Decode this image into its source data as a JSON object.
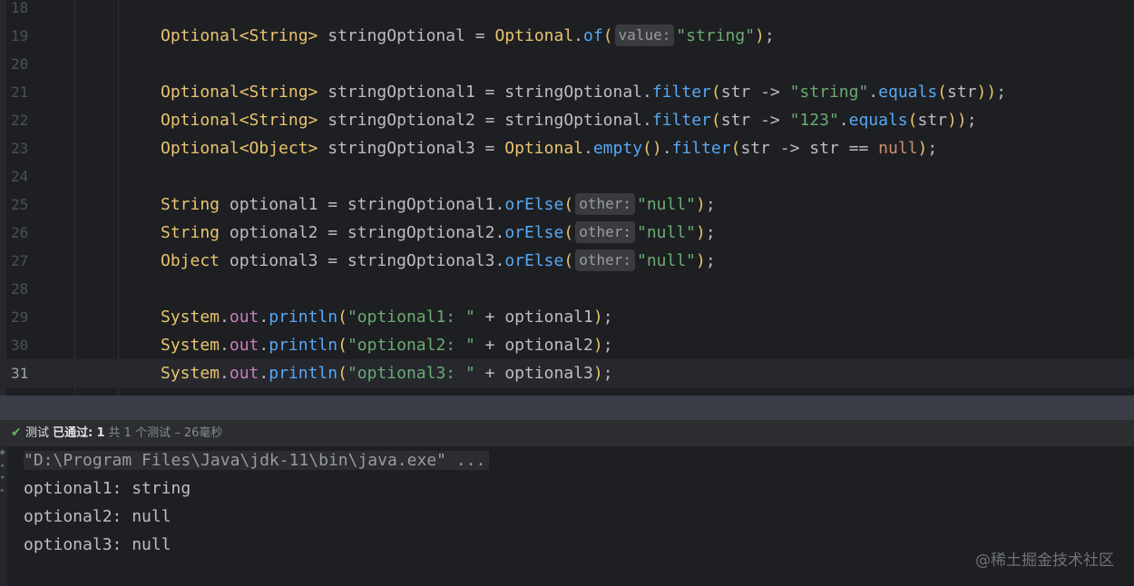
{
  "editor": {
    "lines": [
      {
        "n": "18",
        "tokens": []
      },
      {
        "n": "19",
        "tokens": [
          [
            "t-type",
            "Optional<String>"
          ],
          [
            "t-plain",
            " stringOptional = "
          ],
          [
            "t-type",
            "Optional"
          ],
          [
            "t-plain",
            "."
          ],
          [
            "t-meth",
            "of"
          ],
          [
            "t-type",
            "("
          ],
          [
            "hint",
            "value:"
          ],
          [
            "t-str",
            "\"string\""
          ],
          [
            "t-type",
            ")"
          ],
          [
            "t-plain",
            ";"
          ]
        ]
      },
      {
        "n": "20",
        "tokens": []
      },
      {
        "n": "21",
        "tokens": [
          [
            "t-type",
            "Optional<String>"
          ],
          [
            "t-plain",
            " stringOptional1 = stringOptional."
          ],
          [
            "t-meth",
            "filter"
          ],
          [
            "t-type",
            "("
          ],
          [
            "t-plain",
            "str -> "
          ],
          [
            "t-str",
            "\"string\""
          ],
          [
            "t-plain",
            "."
          ],
          [
            "t-meth",
            "equals"
          ],
          [
            "t-type",
            "("
          ],
          [
            "t-plain",
            "str"
          ],
          [
            "t-type",
            "))"
          ],
          [
            "t-plain",
            ";"
          ]
        ]
      },
      {
        "n": "22",
        "tokens": [
          [
            "t-type",
            "Optional<String>"
          ],
          [
            "t-plain",
            " stringOptional2 = stringOptional."
          ],
          [
            "t-meth",
            "filter"
          ],
          [
            "t-type",
            "("
          ],
          [
            "t-plain",
            "str -> "
          ],
          [
            "t-str",
            "\"123\""
          ],
          [
            "t-plain",
            "."
          ],
          [
            "t-meth",
            "equals"
          ],
          [
            "t-type",
            "("
          ],
          [
            "t-plain",
            "str"
          ],
          [
            "t-type",
            "))"
          ],
          [
            "t-plain",
            ";"
          ]
        ]
      },
      {
        "n": "23",
        "tokens": [
          [
            "t-type",
            "Optional<Object>"
          ],
          [
            "t-plain",
            " stringOptional3 = "
          ],
          [
            "t-type",
            "Optional"
          ],
          [
            "t-plain",
            "."
          ],
          [
            "t-meth",
            "empty"
          ],
          [
            "t-type",
            "()"
          ],
          [
            "t-plain",
            "."
          ],
          [
            "t-meth",
            "filter"
          ],
          [
            "t-type",
            "("
          ],
          [
            "t-plain",
            "str -> str == "
          ],
          [
            "t-kw",
            "null"
          ],
          [
            "t-type",
            ")"
          ],
          [
            "t-plain",
            ";"
          ]
        ]
      },
      {
        "n": "24",
        "tokens": []
      },
      {
        "n": "25",
        "tokens": [
          [
            "t-type",
            "String"
          ],
          [
            "t-plain",
            " optional1 = stringOptional1."
          ],
          [
            "t-meth",
            "orElse"
          ],
          [
            "t-type",
            "("
          ],
          [
            "hint",
            "other:"
          ],
          [
            "t-str",
            "\"null\""
          ],
          [
            "t-type",
            ")"
          ],
          [
            "t-plain",
            ";"
          ]
        ]
      },
      {
        "n": "26",
        "tokens": [
          [
            "t-type",
            "String"
          ],
          [
            "t-plain",
            " optional2 = stringOptional2."
          ],
          [
            "t-meth",
            "orElse"
          ],
          [
            "t-type",
            "("
          ],
          [
            "hint",
            "other:"
          ],
          [
            "t-str",
            "\"null\""
          ],
          [
            "t-type",
            ")"
          ],
          [
            "t-plain",
            ";"
          ]
        ]
      },
      {
        "n": "27",
        "tokens": [
          [
            "t-type",
            "Object"
          ],
          [
            "t-plain",
            " optional3 = stringOptional3."
          ],
          [
            "t-meth",
            "orElse"
          ],
          [
            "t-type",
            "("
          ],
          [
            "hint",
            "other:"
          ],
          [
            "t-str",
            "\"null\""
          ],
          [
            "t-type",
            ")"
          ],
          [
            "t-plain",
            ";"
          ]
        ]
      },
      {
        "n": "28",
        "tokens": []
      },
      {
        "n": "29",
        "tokens": [
          [
            "t-type",
            "System"
          ],
          [
            "t-plain",
            "."
          ],
          [
            "t-field",
            "out"
          ],
          [
            "t-plain",
            "."
          ],
          [
            "t-meth",
            "println"
          ],
          [
            "t-type",
            "("
          ],
          [
            "t-str",
            "\"optional1: \""
          ],
          [
            "t-plain",
            " + optional1"
          ],
          [
            "t-type",
            ")"
          ],
          [
            "t-plain",
            ";"
          ]
        ]
      },
      {
        "n": "30",
        "tokens": [
          [
            "t-type",
            "System"
          ],
          [
            "t-plain",
            "."
          ],
          [
            "t-field",
            "out"
          ],
          [
            "t-plain",
            "."
          ],
          [
            "t-meth",
            "println"
          ],
          [
            "t-type",
            "("
          ],
          [
            "t-str",
            "\"optional2: \""
          ],
          [
            "t-plain",
            " + optional2"
          ],
          [
            "t-type",
            ")"
          ],
          [
            "t-plain",
            ";"
          ]
        ]
      },
      {
        "n": "31",
        "current": true,
        "tokens": [
          [
            "t-type",
            "System"
          ],
          [
            "t-plain",
            "."
          ],
          [
            "t-field",
            "out"
          ],
          [
            "t-plain",
            "."
          ],
          [
            "t-meth",
            "println"
          ],
          [
            "t-type",
            "("
          ],
          [
            "t-str",
            "\"optional3: \""
          ],
          [
            "t-plain",
            " + optional3"
          ],
          [
            "t-type",
            ")"
          ],
          [
            "t-plain",
            ";"
          ]
        ]
      }
    ]
  },
  "run_panel": {
    "status_icon": "check-icon",
    "title_label": "测试",
    "passed_label": "已通过:",
    "passed_count": "1",
    "summary": "共 1 个测试 – 26毫秒"
  },
  "console": {
    "command": "\"D:\\Program Files\\Java\\jdk-11\\bin\\java.exe\" ...",
    "output": [
      "optional1: string",
      "optional2: null",
      "optional3: null"
    ]
  },
  "watermark": "@稀土掘金技术社区"
}
